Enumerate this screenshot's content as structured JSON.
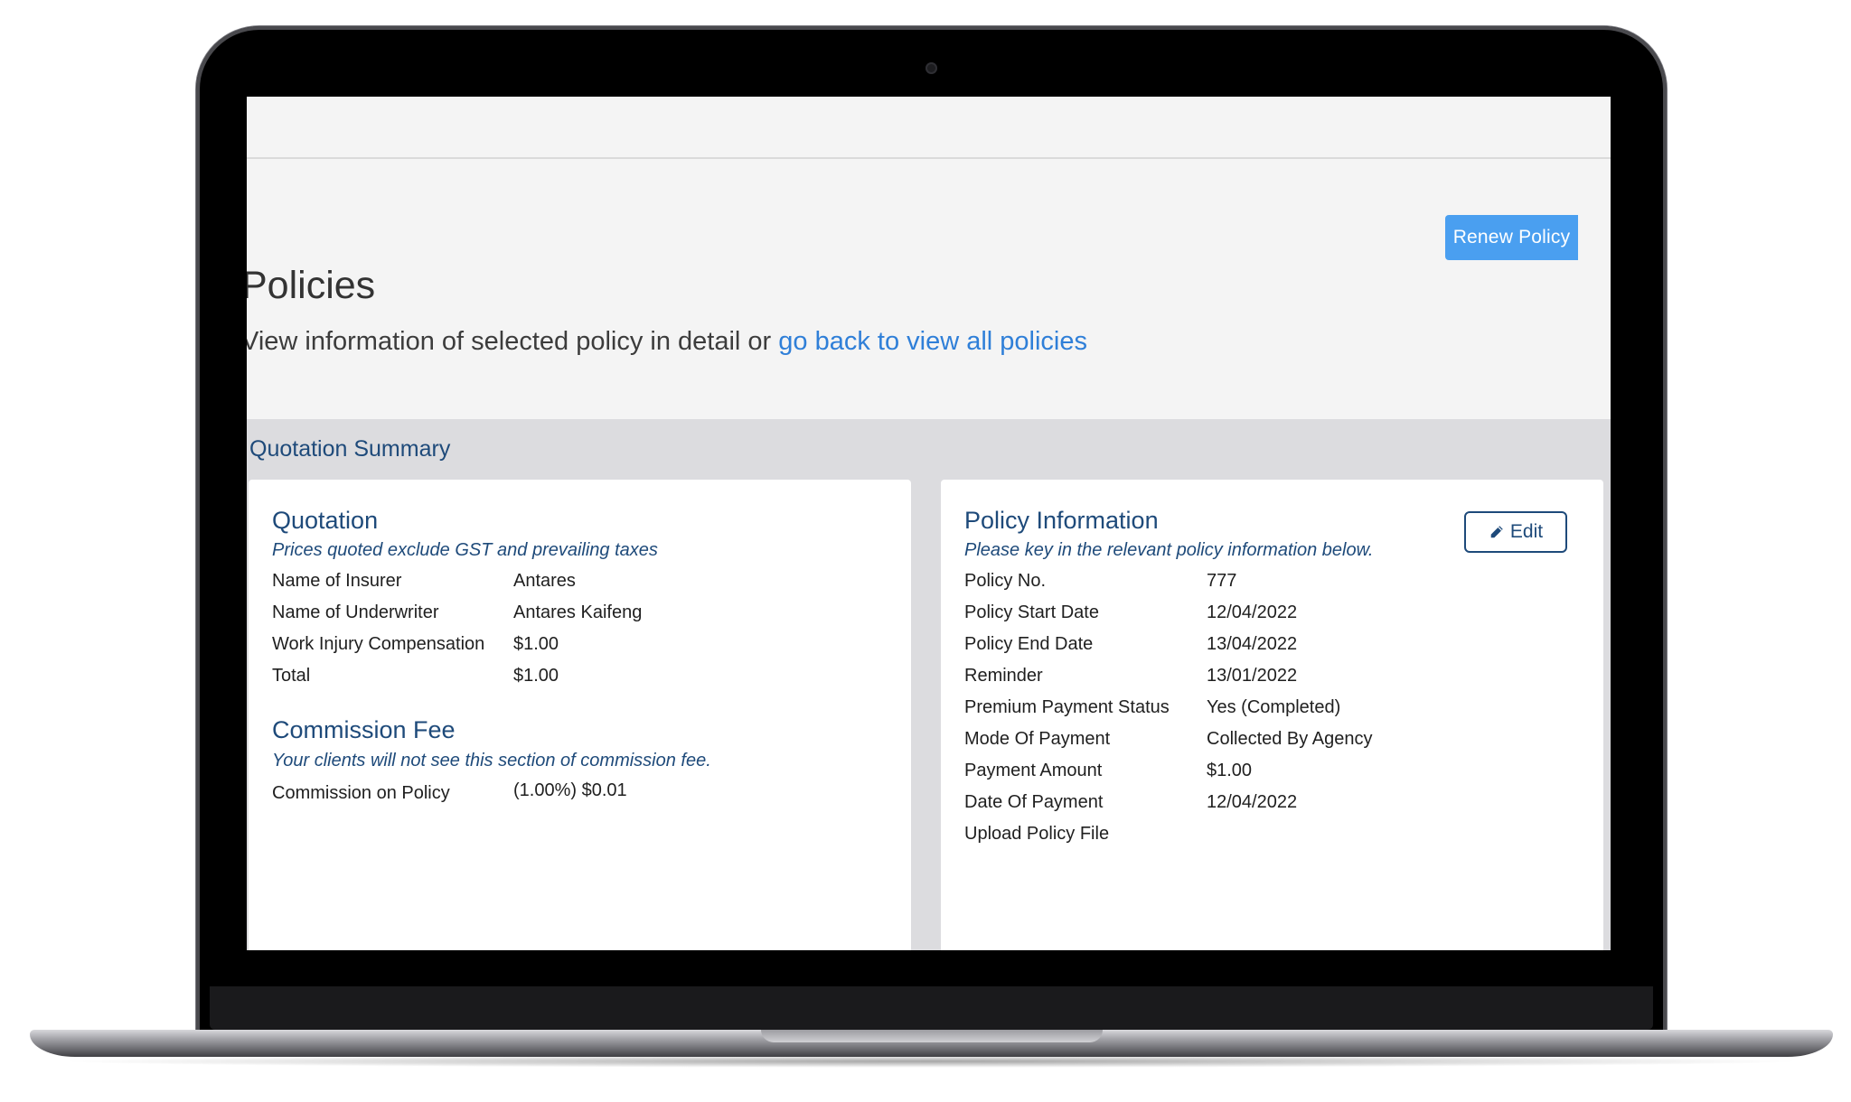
{
  "header": {
    "renew_button": "Renew Policy",
    "title": "Policies",
    "subtitle_prefix": "View information of selected policy in detail or ",
    "subtitle_link": "go back to view all policies"
  },
  "summary": {
    "section_title": "Quotation Summary",
    "quotation": {
      "title": "Quotation",
      "note": "Prices quoted exclude GST and prevailing taxes",
      "rows": [
        {
          "label": "Name of Insurer",
          "value": "Antares"
        },
        {
          "label": "Name of Underwriter",
          "value": "Antares Kaifeng"
        },
        {
          "label": "Work Injury Compensation",
          "value": "$1.00"
        },
        {
          "label": "Total",
          "value": "$1.00"
        }
      ]
    },
    "commission": {
      "title": "Commission Fee",
      "note": "Your clients will not see this section of commission fee.",
      "rows": [
        {
          "label": "Commission on Policy",
          "value": "(1.00%) $0.01"
        }
      ]
    },
    "policy_info": {
      "title": "Policy Information",
      "note": "Please key in the relevant policy information below.",
      "edit_button": "Edit",
      "edit_icon": "pencil-icon",
      "rows": [
        {
          "label": "Policy No.",
          "value": "777"
        },
        {
          "label": "Policy Start Date",
          "value": "12/04/2022"
        },
        {
          "label": "Policy End Date",
          "value": "13/04/2022"
        },
        {
          "label": "Reminder",
          "value": "13/01/2022"
        },
        {
          "label": "Premium Payment Status",
          "value": "Yes (Completed)"
        },
        {
          "label": "Mode Of Payment",
          "value": "Collected By Agency"
        },
        {
          "label": "Payment Amount",
          "value": "$1.00"
        },
        {
          "label": "Date Of Payment",
          "value": "12/04/2022"
        },
        {
          "label": "Upload Policy File",
          "value": ""
        }
      ]
    }
  },
  "colors": {
    "accent_blue": "#4a9ff0",
    "link_blue": "#2f7fd8",
    "heading_navy": "#1e4a7a"
  }
}
